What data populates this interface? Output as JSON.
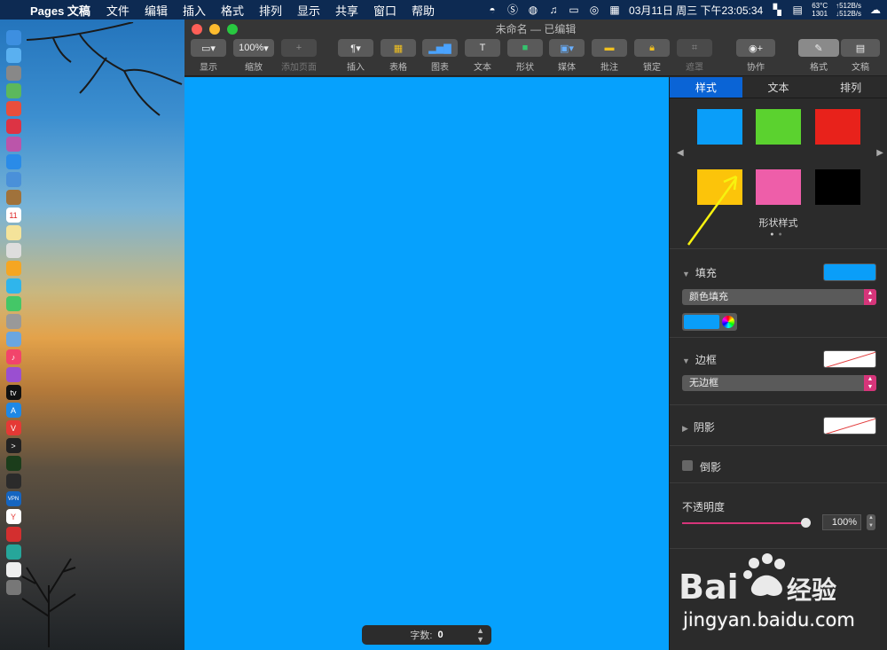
{
  "menubar": {
    "app_name": "Pages 文稿",
    "menus": [
      "文件",
      "编辑",
      "插入",
      "格式",
      "排列",
      "显示",
      "共享",
      "窗口",
      "帮助"
    ],
    "temp": "63°C",
    "temp_sub": "1301",
    "net_up": "↑512B/s",
    "net_down": "↓512B/s",
    "datetime": "03月11日 周三 下午23:05:34"
  },
  "window": {
    "title": "未命名 — 已编辑",
    "toolbar": {
      "display": "显示",
      "zoom_value": "100%",
      "zoom": "缩放",
      "add_page": "添加页面",
      "insert": "插入",
      "table": "表格",
      "chart": "图表",
      "text": "文本",
      "shape": "形状",
      "media": "媒体",
      "comment": "批注",
      "lock": "锁定",
      "mask": "遮罩",
      "collaborate": "协作",
      "format": "格式",
      "document": "文稿"
    },
    "wordcount": {
      "label": "字数:",
      "value": "0"
    }
  },
  "inspector": {
    "tabs": [
      "样式",
      "文本",
      "排列"
    ],
    "swatch_colors": [
      "#0a9ef9",
      "#5bd22f",
      "#e8221b",
      "#fcc40a",
      "#ee5ea9",
      "#000000"
    ],
    "shape_style_label": "形状样式",
    "fill": {
      "label": "填充",
      "color": "#0a9ef9",
      "type": "颜色填充"
    },
    "border": {
      "label": "边框",
      "type": "无边框"
    },
    "shadow": {
      "label": "阴影"
    },
    "reflection": {
      "label": "倒影"
    },
    "opacity": {
      "label": "不透明度",
      "value": "100%",
      "level": 1.0
    }
  },
  "watermark": {
    "text": "jingyan.baidu.com",
    "brand": "Bai du 经验"
  },
  "accent_color": "#0a64d6",
  "canvas_color": "#06a1fd"
}
